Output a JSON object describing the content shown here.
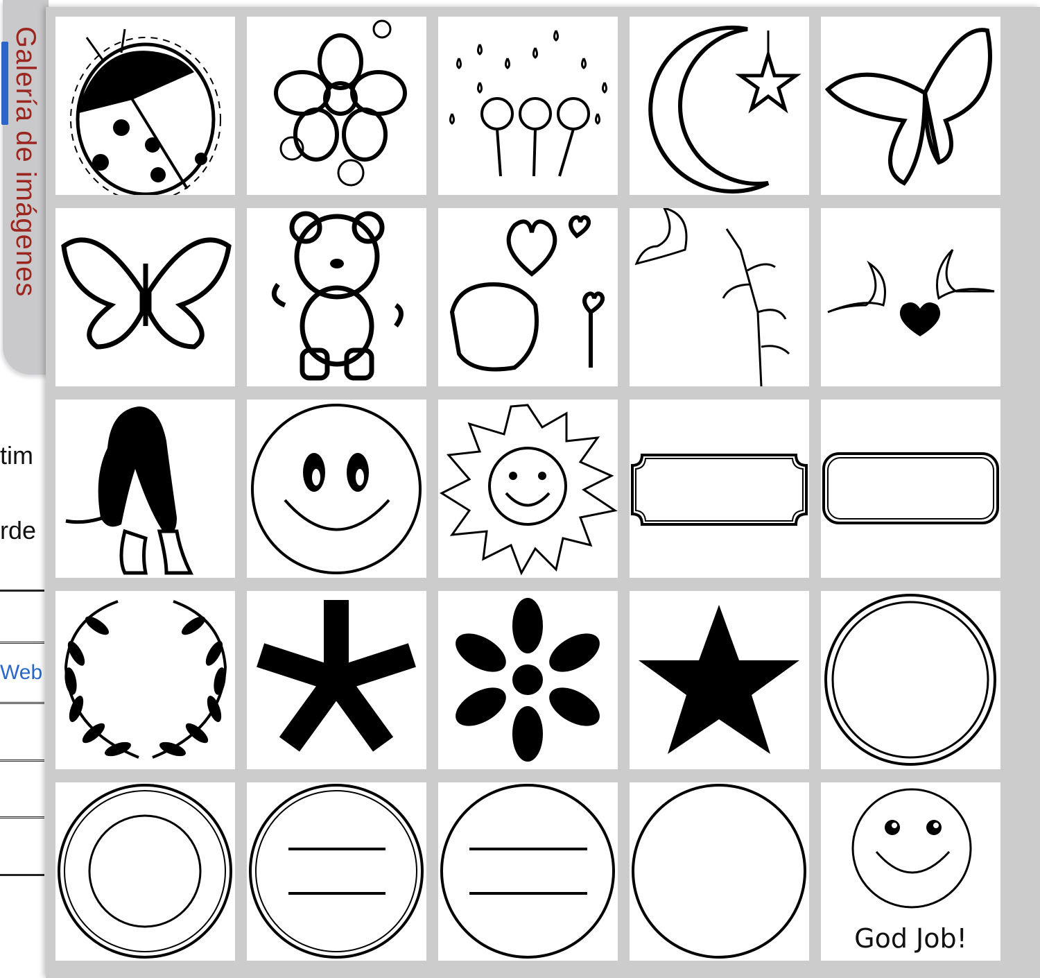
{
  "background_page": {
    "fragment_1": "tim",
    "fragment_2": "rde",
    "fragment_3_link": "Web"
  },
  "gallery": {
    "tab_label": "Galería de imágenes",
    "tiles": [
      {
        "icon": "ladybug-icon"
      },
      {
        "icon": "flower-icon"
      },
      {
        "icon": "flowers-rain-icon"
      },
      {
        "icon": "moon-star-icon"
      },
      {
        "icon": "butterfly-icon"
      },
      {
        "icon": "butterfly-outline-icon"
      },
      {
        "icon": "teddy-bear-icon"
      },
      {
        "icon": "bear-heart-icon"
      },
      {
        "icon": "dove-branch-icon"
      },
      {
        "icon": "doves-heart-icon"
      },
      {
        "icon": "basset-dog-icon"
      },
      {
        "icon": "smiley-face-icon"
      },
      {
        "icon": "smiling-sun-icon"
      },
      {
        "icon": "notched-label-frame-icon"
      },
      {
        "icon": "rounded-label-frame-icon"
      },
      {
        "icon": "laurel-wreath-icon"
      },
      {
        "icon": "asterisk-icon"
      },
      {
        "icon": "flower-asterisk-icon"
      },
      {
        "icon": "star-icon"
      },
      {
        "icon": "double-circle-icon"
      },
      {
        "icon": "ring-circle-icon"
      },
      {
        "icon": "circle-two-lines-double-icon"
      },
      {
        "icon": "circle-two-lines-icon"
      },
      {
        "icon": "single-circle-icon"
      },
      {
        "icon": "smiley-stamp-icon",
        "caption": "God Job!"
      }
    ]
  }
}
